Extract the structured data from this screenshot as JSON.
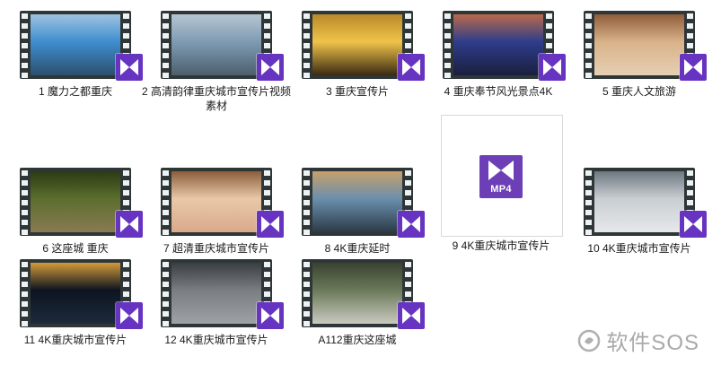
{
  "files": [
    {
      "label": "1 魔力之都重庆",
      "colors": [
        "#3e8ed0",
        "#9fc3e0",
        "#2b4f6d"
      ]
    },
    {
      "label": "2 高清韵律重庆城市宣传片视频素材",
      "colors": [
        "#7e9bb3",
        "#b6c6d2",
        "#4d5f6c"
      ]
    },
    {
      "label": "3 重庆宣传片",
      "colors": [
        "#f0c34a",
        "#b88a2a",
        "#3a2a12"
      ]
    },
    {
      "label": "4 重庆奉节风光景点4K",
      "colors": [
        "#2e3d8c",
        "#b96a4a",
        "#1b1f3d"
      ]
    },
    {
      "label": "5 重庆人文旅游",
      "colors": [
        "#d9b28a",
        "#8e5d3a",
        "#e5cfb2"
      ]
    },
    {
      "label": "6 这座城  重庆",
      "colors": [
        "#5c6e2e",
        "#2d3a14",
        "#8a7a52"
      ]
    },
    {
      "label": "7 超清重庆城市宣传片",
      "colors": [
        "#e8c9a8",
        "#8c5e3c",
        "#d9a98a"
      ]
    },
    {
      "label": "8 4K重庆延时",
      "colors": [
        "#6a8fae",
        "#c7a06a",
        "#2c3a46"
      ]
    },
    {
      "label": "9 4K重庆城市宣传片",
      "mp4": true,
      "badge": "MP4"
    },
    {
      "label": "10 4K重庆城市宣传片",
      "colors": [
        "#c9ced3",
        "#6e7880",
        "#e6e8ea"
      ]
    },
    {
      "label": "11 4K重庆城市宣传片",
      "colors": [
        "#0d1420",
        "#d29a3a",
        "#1e2a3c"
      ]
    },
    {
      "label": "12 4K重庆城市宣传片",
      "colors": [
        "#7a7e82",
        "#3a3e42",
        "#9ea2a6"
      ]
    },
    {
      "label": "A112重庆这座城",
      "colors": [
        "#6b7a5a",
        "#3a4230",
        "#c9c9c0"
      ]
    }
  ],
  "watermark": {
    "text": "软件SOS"
  },
  "accent_color": "#6733c1"
}
